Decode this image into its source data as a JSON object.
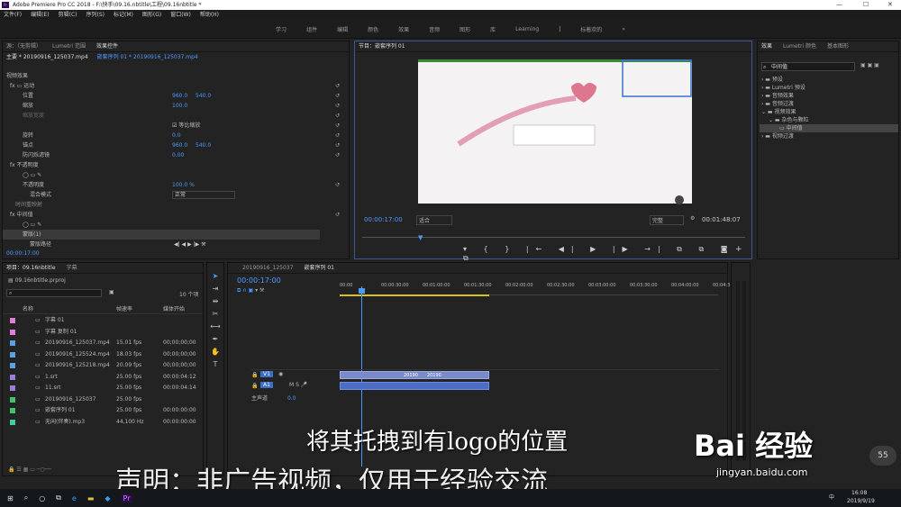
{
  "window": {
    "title": "Adobe Premiere Pro CC 2018 - F:\\快手\\09.16.nbtitle\\工程\\09.16nbtitle *"
  },
  "menu": [
    "文件(F)",
    "编辑(E)",
    "剪辑(C)",
    "序列(S)",
    "标记(M)",
    "图形(G)",
    "窗口(W)",
    "帮助(H)"
  ],
  "workspaces": [
    "学习",
    "组件",
    "编辑",
    "颜色",
    "效果",
    "音频",
    "图形",
    "库",
    "Learning",
    "标着欢的"
  ],
  "source": {
    "tabs": [
      "源：（无剪辑）",
      "Lumetri 范围",
      "效果控件"
    ],
    "clip_path": "主要 * 20190916_125037.mp4",
    "seq_path": "嵌套序列 01 * 20190916_125037.mp4",
    "section_video": "视频效果",
    "motion": "运动",
    "position": {
      "label": "位置",
      "x": "960.0",
      "y": "540.0"
    },
    "scale": {
      "label": "缩放",
      "v": "100.0"
    },
    "scale_w": {
      "label": "缩放宽度"
    },
    "uniform": "等比缩放",
    "rotation": {
      "label": "旋转",
      "v": "0.0"
    },
    "anchor": {
      "label": "锚点",
      "x": "960.0",
      "y": "540.0"
    },
    "flicker": {
      "label": "防闪烁滤镜",
      "v": "0.00"
    },
    "opacity_sec": "不透明度",
    "opacity": {
      "label": "不透明度",
      "v": "100.0 %"
    },
    "blend": {
      "label": "混合模式",
      "v": "正常"
    },
    "remap": "时间重映射",
    "midtone": "中间值",
    "mask": "蒙版(1)",
    "mask_path": "蒙版路径",
    "time": "00:00:17:00"
  },
  "program": {
    "tab": "节目：嵌套序列 01",
    "time": "00:00:17:00",
    "fit": "适合",
    "quality": "完整",
    "duration": "00:01:48:07"
  },
  "effects": {
    "tabs": [
      "效果",
      "Lumetri 颜色",
      "基本图形"
    ],
    "search": "中间值",
    "tree": [
      "预设",
      "Lumetri 预设",
      "音频效果",
      "音频过渡",
      "视频效果",
      "杂色与颗粒",
      "中间值",
      "视频过渡"
    ]
  },
  "project": {
    "tabs": [
      "项目：09.16nbtitle",
      "字幕"
    ],
    "file": "09.16nbtitle.prproj",
    "count": "10 个项",
    "headers": [
      "名称",
      "帧速率",
      "媒体开始"
    ],
    "items": [
      {
        "name": "字幕 01",
        "fps": "",
        "start": "",
        "color": "#e27ed8"
      },
      {
        "name": "字幕 复制 01",
        "fps": "",
        "start": "",
        "color": "#e27ed8"
      },
      {
        "name": "20190916_125037.mp4",
        "fps": "15.01 fps",
        "start": "00;00;00;00",
        "color": "#5e9ee6"
      },
      {
        "name": "20190916_125524.mp4",
        "fps": "18.03 fps",
        "start": "00;00;00;00",
        "color": "#5e9ee6"
      },
      {
        "name": "20190916_125218.mp4",
        "fps": "20.09 fps",
        "start": "00;00;00;00",
        "color": "#5e9ee6"
      },
      {
        "name": "1.srt",
        "fps": "25.00 fps",
        "start": "00:00:04:12",
        "color": "#9b7ed8"
      },
      {
        "name": "11.srt",
        "fps": "25.00 fps",
        "start": "00:00:04:14",
        "color": "#9b7ed8"
      },
      {
        "name": "20190916_125037",
        "fps": "25.00 fps",
        "start": "",
        "color": "#3fc46a"
      },
      {
        "name": "嵌套序列 01",
        "fps": "25.00 fps",
        "start": "00:00:00:00",
        "color": "#3fc46a"
      },
      {
        "name": "无闲(伴奏).mp3",
        "fps": "44,100 Hz",
        "start": "00:00:00:00",
        "color": "#3fcf9a"
      }
    ]
  },
  "timeline": {
    "tabs": [
      "20190916_125037",
      "嵌套序列 01"
    ],
    "time": "00:00:17:00",
    "ruler": [
      "00:00",
      "00:00:30:00",
      "00:01:00:00",
      "00:01:30:00",
      "00:02:00:00",
      "00:02:30:00",
      "00:03:00:00",
      "00:03:30:00",
      "00:04:00:00",
      "00:04:3"
    ],
    "tracks": {
      "v1": "V1",
      "a1": "A1",
      "master": "主声道",
      "master_val": "0.0"
    },
    "clip_labels": [
      "20190",
      "20190"
    ]
  },
  "overlay": {
    "subtitle": "将其托拽到有logo的位置",
    "disclaimer": "声明：非广告视频，仅用于经验交流",
    "watermark": "Bai 经验",
    "wm_url": "jingyan.baidu.com",
    "badge": "55"
  },
  "taskbar": {
    "time": "16:08",
    "date": "2019/9/19",
    "lang": "中"
  }
}
